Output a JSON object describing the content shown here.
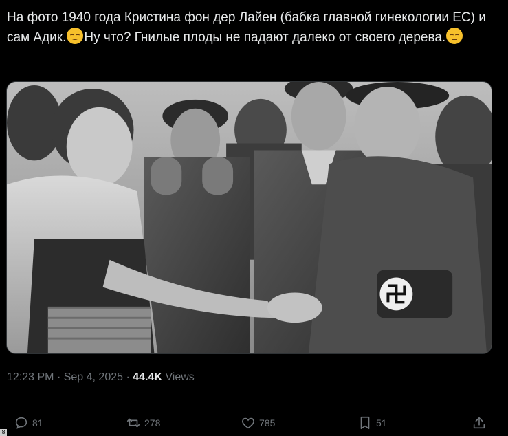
{
  "tweet": {
    "text_part1": "На фото 1940 года Кристина фон дер Лайен (бабка главной гинекологии ЕС) и сам Адик.",
    "emoji1": "relieved-face-emoji",
    "text_part2": "Ну что?  Гнилые плоды не падают далеко от своего дерева.",
    "emoji2": "unamused-face-emoji"
  },
  "media": {
    "type": "black-and-white historical photo",
    "icon": "photo"
  },
  "meta": {
    "time": "12:23 PM",
    "separator": "·",
    "date": "Sep 4, 2025",
    "views_count": "44.4K",
    "views_label": "Views"
  },
  "actions": {
    "reply_count": "81",
    "repost_count": "278",
    "like_count": "785",
    "bookmark_count": "51"
  },
  "corner_badge": "8",
  "colors": {
    "background": "#000000",
    "text": "#e7e9ea",
    "muted": "#71767b",
    "border": "#2f3336"
  }
}
